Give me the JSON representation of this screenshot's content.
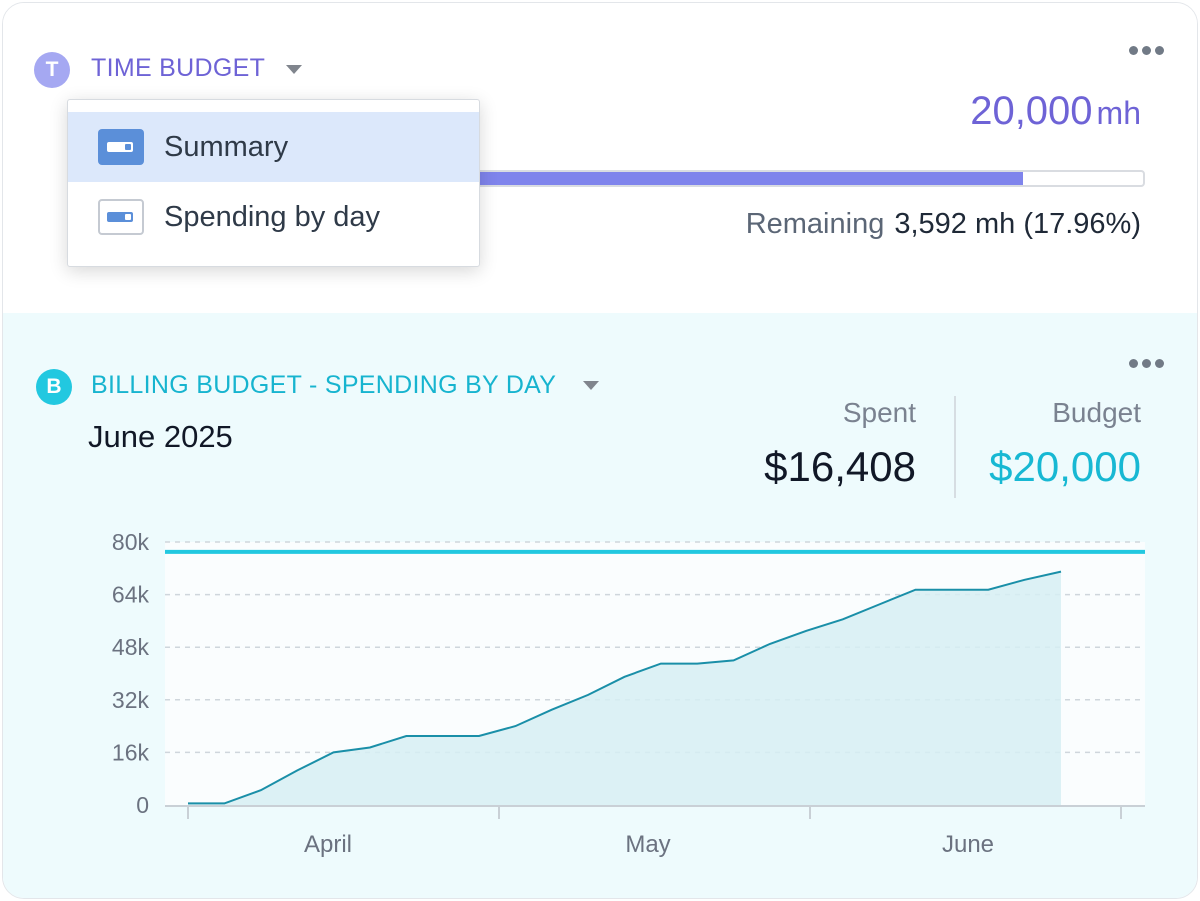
{
  "time_budget": {
    "badge_letter": "T",
    "title": "TIME BUDGET",
    "total_value": "20,000",
    "total_unit": "mh",
    "progress_fraction": 0.8204,
    "remaining_label": "Remaining",
    "remaining_value": "3,592 mh (17.96%)",
    "dropdown": {
      "items": [
        {
          "label": "Summary",
          "selected": true,
          "icon": "summary-widget-icon"
        },
        {
          "label": "Spending by day",
          "selected": false,
          "icon": "spending-widget-icon"
        }
      ]
    }
  },
  "billing_budget": {
    "badge_letter": "B",
    "title": "BILLING BUDGET - SPENDING BY DAY",
    "period": "June 2025",
    "spent_label": "Spent",
    "spent_value": "$16,408",
    "budget_label": "Budget",
    "budget_value": "$20,000"
  },
  "colors": {
    "time_accent": "#6e63d6",
    "billing_accent": "#17b8d3",
    "progress_fill": "#7f84ec",
    "line": "#1a8fa8",
    "area": "#d6eef3",
    "budget_line": "#22c8e0"
  },
  "chart_data": {
    "type": "area",
    "title": "",
    "xlabel": "",
    "ylabel": "",
    "ylim": [
      0,
      80000
    ],
    "y_ticks": [
      "0",
      "16k",
      "32k",
      "48k",
      "64k",
      "80k"
    ],
    "x_tick_labels": [
      "April",
      "May",
      "June"
    ],
    "grid": true,
    "budget_line_value": 77000,
    "series": [
      {
        "values": [
          500,
          500,
          4500,
          10500,
          16000,
          17500,
          21000,
          21000,
          21000,
          24000,
          29000,
          33500,
          39000,
          43000,
          43000,
          44000,
          49000,
          53000,
          56500,
          61000,
          65500,
          65500,
          65500,
          68500,
          71000
        ]
      }
    ]
  }
}
